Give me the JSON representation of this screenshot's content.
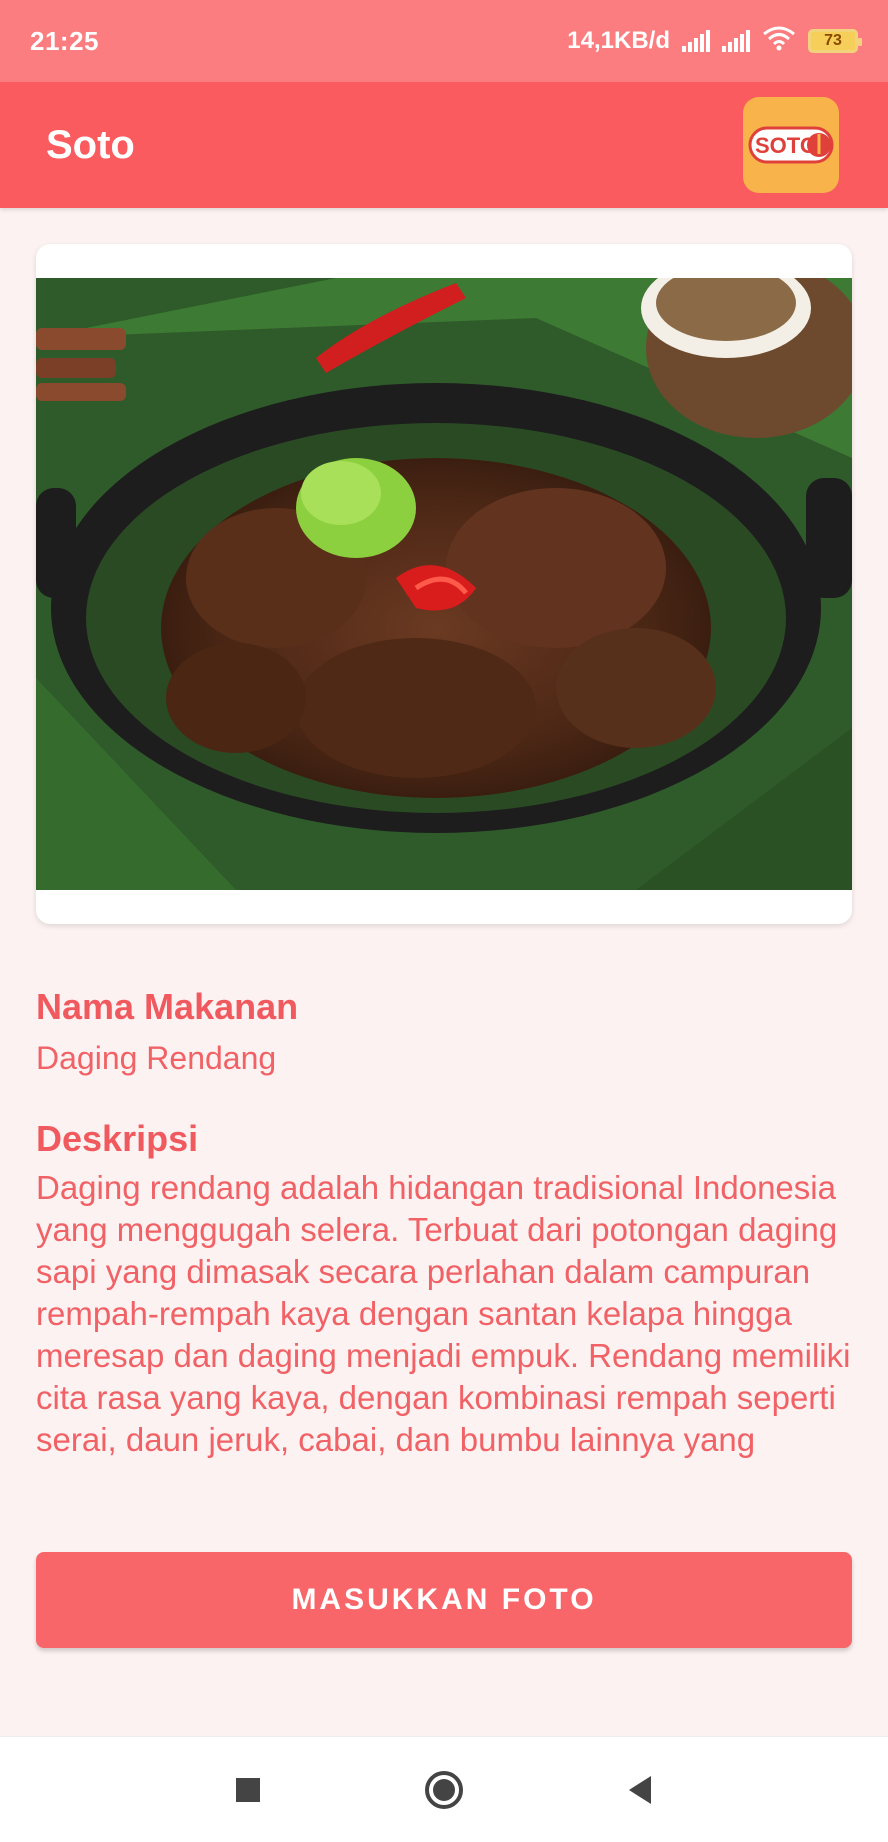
{
  "status_bar": {
    "time": "21:25",
    "network_speed": "14,1KB/d",
    "battery": "73"
  },
  "app_bar": {
    "title": "Soto",
    "logo_text": "SOTO"
  },
  "food": {
    "name_label": "Nama Makanan",
    "name_value": "Daging Rendang",
    "description_label": "Deskripsi",
    "description_text": "Daging rendang adalah hidangan tradisional Indonesia yang menggugah selera. Terbuat dari potongan daging sapi yang dimasak secara perlahan dalam campuran rempah-rempah kaya dengan santan kelapa hingga meresap dan daging menjadi empuk. Rendang memiliki cita rasa yang kaya, dengan kombinasi rempah seperti serai, daun jeruk, cabai, dan bumbu lainnya yang"
  },
  "actions": {
    "upload_button": "MASUKKAN FOTO"
  },
  "colors": {
    "status_bar": "#fc7d7f",
    "app_bar": "#fa5b5e",
    "accent_text": "#f05a5f",
    "button": "#f9666a",
    "background": "#fdf2f2"
  },
  "icons": {
    "wifi": "wifi-icon",
    "signal": "signal-icon",
    "battery": "battery-icon",
    "nav_recents": "square-icon",
    "nav_home": "circle-icon",
    "nav_back": "triangle-back-icon"
  }
}
